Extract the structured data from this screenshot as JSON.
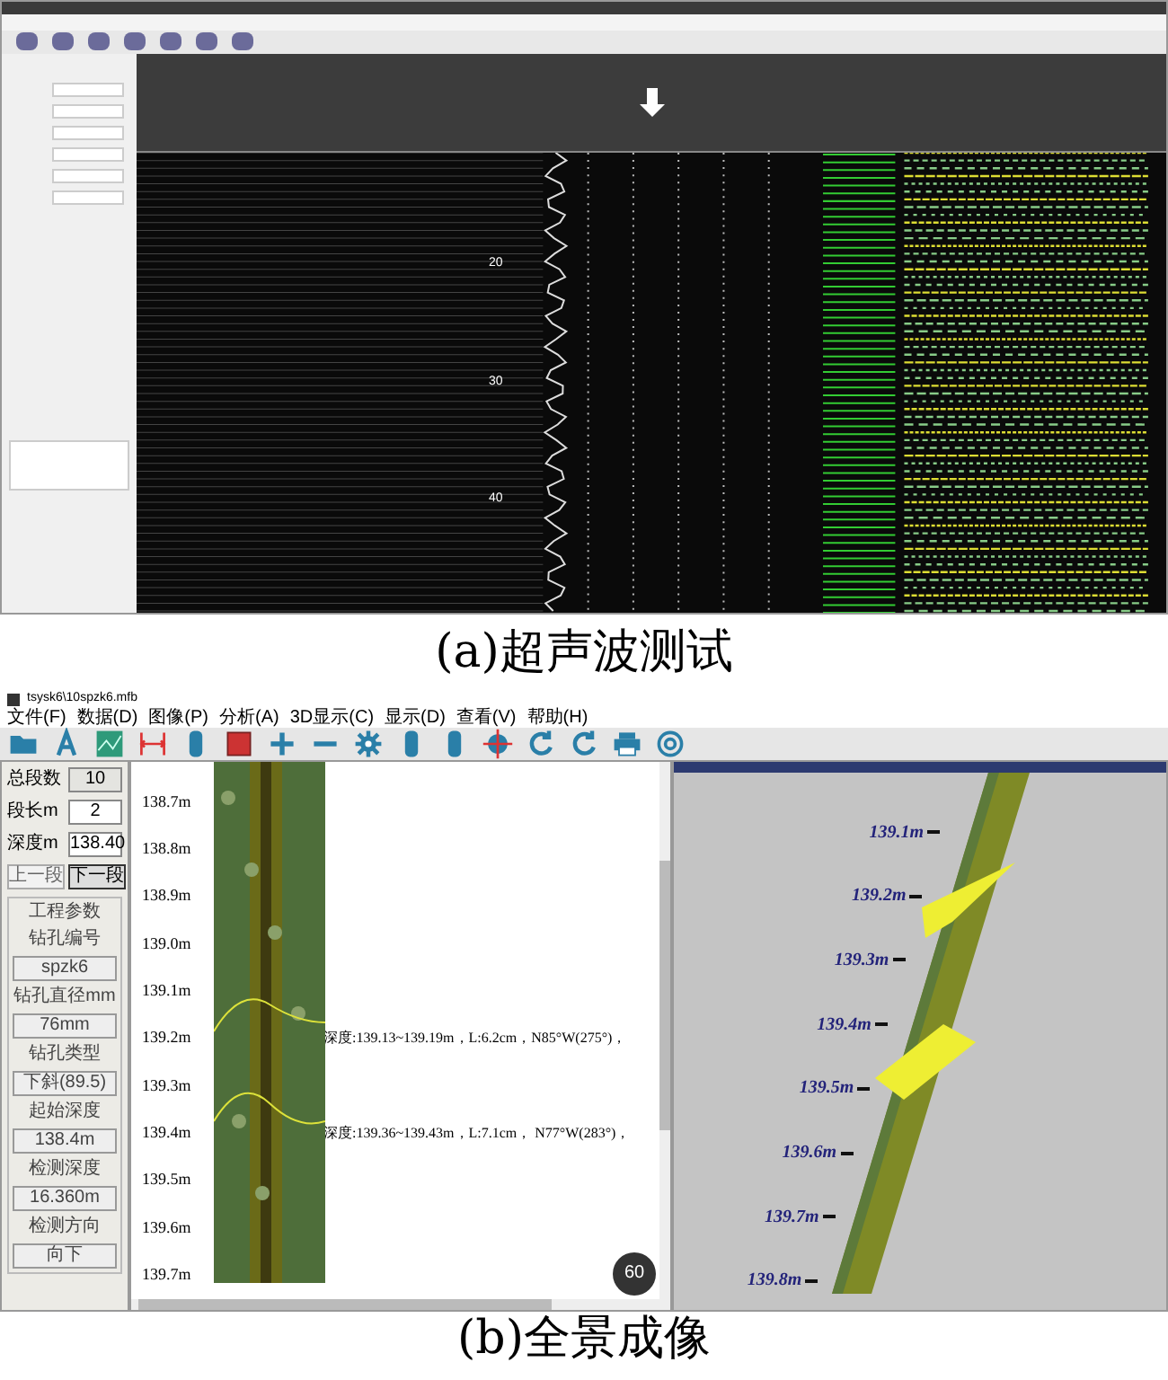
{
  "figure_a": {
    "caption": "(a)超声波测试",
    "depth_marks": [
      "20",
      "30",
      "40"
    ]
  },
  "figure_b": {
    "caption": "(b)全景成像",
    "window": {
      "title": "tsysk6\\10spzk6.mfb"
    },
    "menu": [
      "文件(F)",
      "数据(D)",
      "图像(P)",
      "分析(A)",
      "3D显示(C)",
      "显示(D)",
      "查看(V)",
      "帮助(H)"
    ],
    "nav": {
      "fields": [
        {
          "label": "总段数",
          "value": "10",
          "editable": false
        },
        {
          "label": "段长m",
          "value": "2",
          "editable": true
        },
        {
          "label": "深度m",
          "value": "138.40",
          "editable": true
        }
      ],
      "buttons": [
        {
          "label": "上一段",
          "selected": false
        },
        {
          "label": "下一段",
          "selected": true
        }
      ]
    },
    "params": {
      "title": "工程参数",
      "items": [
        {
          "label": "钻孔编号",
          "value": "spzk6"
        },
        {
          "label": "钻孔直径mm",
          "value": "76mm"
        },
        {
          "label": "钻孔类型",
          "value": "下斜(89.5)"
        },
        {
          "label": "起始深度",
          "value": "138.4m"
        },
        {
          "label": "检测深度",
          "value": "16.360m"
        },
        {
          "label": "检测方向",
          "value": "向下"
        }
      ]
    },
    "depth_rows": [
      {
        "depth": "138.7m"
      },
      {
        "depth": "138.8m"
      },
      {
        "depth": "138.9m"
      },
      {
        "depth": "139.0m"
      },
      {
        "depth": "139.1m"
      },
      {
        "depth": "139.2m",
        "note": "深度:139.13~139.19m，L:6.2cm，N85°W(275°)，"
      },
      {
        "depth": "139.3m"
      },
      {
        "depth": "139.4m",
        "note": "深度:139.36~139.43m，L:7.1cm， N77°W(283°)，"
      },
      {
        "depth": "139.5m"
      },
      {
        "depth": "139.6m"
      },
      {
        "depth": "139.7m"
      }
    ],
    "view3d": {
      "depth_labels": [
        "139.1m",
        "139.2m",
        "139.3m",
        "139.4m",
        "139.5m",
        "139.6m",
        "139.7m",
        "139.8m"
      ]
    },
    "zoom_badge": "60"
  }
}
